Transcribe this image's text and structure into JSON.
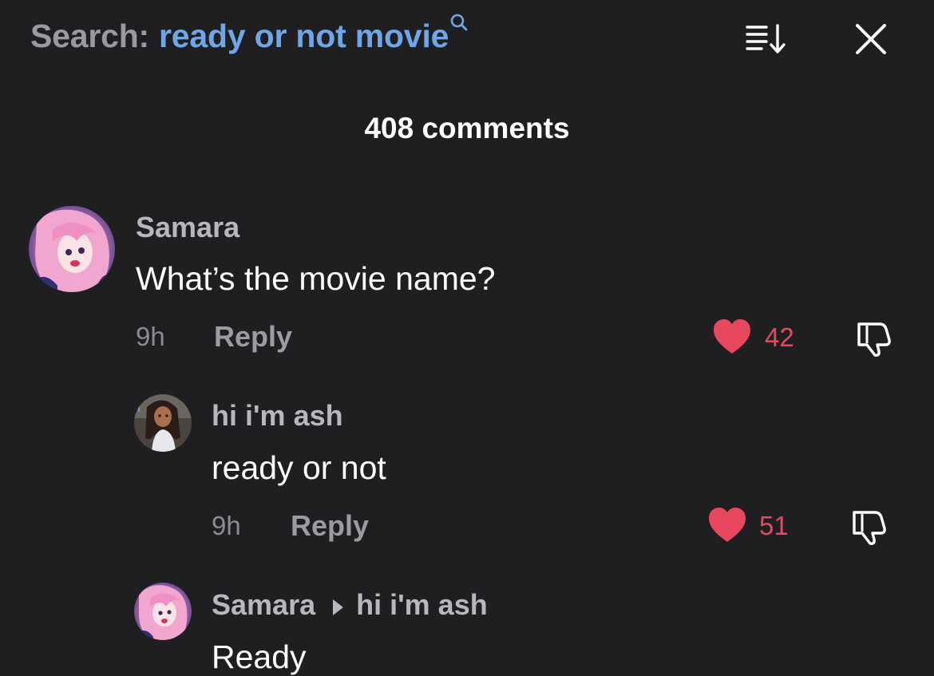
{
  "header": {
    "search_prefix": "Search:",
    "search_query": "ready or not movie",
    "icons": {
      "search": "search-icon",
      "sort": "sort-icon",
      "close": "close-icon"
    }
  },
  "comment_count": "408 comments",
  "colors": {
    "background": "#1f1f21",
    "accent_link": "#6fa6e8",
    "like_red": "#e8485f",
    "muted_text": "#9c9ca0"
  },
  "comments": [
    {
      "username": "Samara",
      "text": "What’s the movie name?",
      "time": "9h",
      "reply_label": "Reply",
      "likes": "42",
      "liked": true
    },
    {
      "username": "hi i'm ash",
      "text": "ready or not",
      "time": "9h",
      "reply_label": "Reply",
      "likes": "51",
      "liked": true
    },
    {
      "username": "Samara",
      "reply_to": "hi i'm ash",
      "text": "Ready"
    }
  ]
}
